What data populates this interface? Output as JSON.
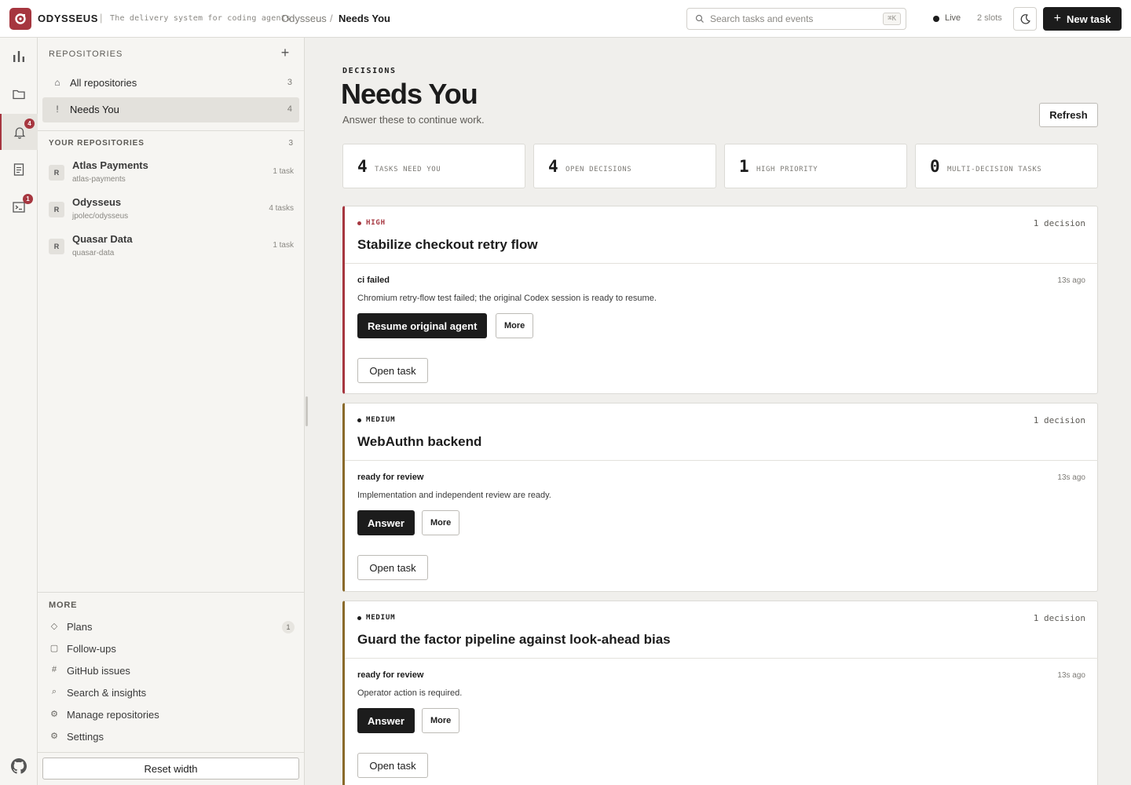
{
  "app": {
    "name": "ODYSSEUS",
    "tagline": "The delivery system for coding agents"
  },
  "breadcrumb": {
    "root": "Odysseus",
    "separator": "/",
    "current": "Needs You"
  },
  "search": {
    "placeholder": "Search tasks and events",
    "shortcut": "⌘K"
  },
  "status": {
    "live": "Live",
    "slots": "2 slots"
  },
  "topbar": {
    "new_task": "New task"
  },
  "rail": {
    "items": [
      {
        "name": "insights",
        "icon": "bar-chart-icon"
      },
      {
        "name": "repositories",
        "icon": "folder-icon"
      },
      {
        "name": "needs-you",
        "icon": "bell-icon",
        "badge": "4",
        "active": true
      },
      {
        "name": "documents",
        "icon": "document-icon"
      },
      {
        "name": "terminal",
        "icon": "terminal-icon",
        "badge": "1"
      }
    ],
    "github_icon": "github-icon"
  },
  "sidebar": {
    "heading": "REPOSITORIES",
    "nav": [
      {
        "icon": "⌂",
        "label": "All repositories",
        "count": "3"
      },
      {
        "icon": "!",
        "label": "Needs You",
        "count": "4",
        "active": true
      }
    ],
    "your_heading": "YOUR REPOSITORIES",
    "your_count": "3",
    "repos": [
      {
        "avatar": "R",
        "name": "Atlas Payments",
        "slug": "atlas-payments",
        "tasks": "1 task"
      },
      {
        "avatar": "R",
        "name": "Odysseus",
        "slug": "jpolec/odysseus",
        "tasks": "4 tasks"
      },
      {
        "avatar": "R",
        "name": "Quasar Data",
        "slug": "quasar-data",
        "tasks": "1 task"
      }
    ],
    "more_heading": "MORE",
    "more": [
      {
        "icon": "◇",
        "label": "Plans",
        "count": "1"
      },
      {
        "icon": "▢",
        "label": "Follow-ups"
      },
      {
        "icon": "#",
        "label": "GitHub issues"
      },
      {
        "icon": "⌕",
        "label": "Search & insights"
      },
      {
        "icon": "⚙",
        "label": "Manage repositories"
      },
      {
        "icon": "⚙",
        "label": "Settings"
      }
    ],
    "reset_width": "Reset width"
  },
  "main": {
    "eyebrow": "DECISIONS",
    "title": "Needs You",
    "subtitle": "Answer these to continue work.",
    "refresh": "Refresh",
    "stats": [
      {
        "value": "4",
        "label": "TASKS NEED YOU"
      },
      {
        "value": "4",
        "label": "OPEN DECISIONS"
      },
      {
        "value": "1",
        "label": "HIGH PRIORITY"
      },
      {
        "value": "0",
        "label": "MULTI-DECISION TASKS"
      }
    ],
    "cards": [
      {
        "priority": "HIGH",
        "decisions": "1 decision",
        "title": "Stabilize checkout retry flow",
        "kind": "ci failed",
        "ago": "13s ago",
        "description": "Chromium retry-flow test failed; the original Codex session is ready to resume.",
        "primary": "Resume original agent",
        "more": "More",
        "open": "Open task"
      },
      {
        "priority": "MEDIUM",
        "decisions": "1 decision",
        "title": "WebAuthn backend",
        "kind": "ready for review",
        "ago": "13s ago",
        "description": "Implementation and independent review are ready.",
        "primary": "Answer",
        "more": "More",
        "open": "Open task"
      },
      {
        "priority": "MEDIUM",
        "decisions": "1 decision",
        "title": "Guard the factor pipeline against look-ahead bias",
        "kind": "ready for review",
        "ago": "13s ago",
        "description": "Operator action is required.",
        "primary": "Answer",
        "more": "More",
        "open": "Open task"
      }
    ]
  },
  "colors": {
    "accent": "#a6363f",
    "medium": "#8a6a2a",
    "ink": "#1c1c1c",
    "canvas": "#f0efec"
  }
}
